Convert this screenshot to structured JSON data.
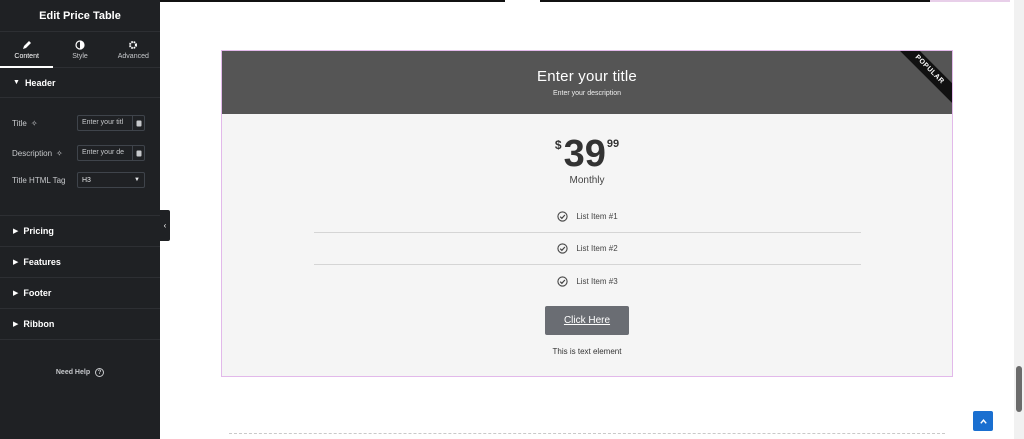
{
  "sidebar": {
    "title": "Edit Price Table",
    "tabs": [
      {
        "label": "Content",
        "icon": "pencil-icon",
        "active": true
      },
      {
        "label": "Style",
        "icon": "contrast-icon",
        "active": false
      },
      {
        "label": "Advanced",
        "icon": "gear-icon",
        "active": false
      }
    ],
    "header_section": {
      "label": "Header",
      "title_label": "Title",
      "title_value": "Enter your titl",
      "description_label": "Description",
      "description_value": "Enter your de",
      "html_tag_label": "Title HTML Tag",
      "html_tag_value": "H3"
    },
    "sections": [
      "Pricing",
      "Features",
      "Footer",
      "Ribbon"
    ],
    "need_help": "Need Help"
  },
  "price_table": {
    "title": "Enter your title",
    "description": "Enter your description",
    "ribbon": "POPULAR",
    "currency": "$",
    "amount": "39",
    "fraction": "99",
    "period": "Monthly",
    "features": [
      "List Item #1",
      "List Item #2",
      "List Item #3"
    ],
    "button": "Click Here",
    "footer_text": "This is text element"
  },
  "colors": {
    "sidebar_bg": "#1f2124",
    "header_bg": "#555555",
    "button_bg": "#6a6d73",
    "accent": "#1a6fd0"
  }
}
